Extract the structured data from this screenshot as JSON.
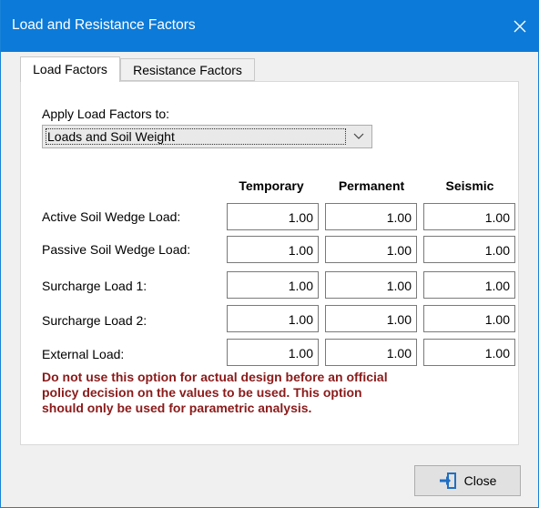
{
  "window": {
    "title": "Load and Resistance Factors"
  },
  "tabs": [
    {
      "label": "Load Factors",
      "active": true
    },
    {
      "label": "Resistance Factors",
      "active": false
    }
  ],
  "apply": {
    "label": "Apply Load Factors to:",
    "selected": "Loads and Soil Weight"
  },
  "columns": [
    "Temporary",
    "Permanent",
    "Seismic"
  ],
  "rows": [
    {
      "label": "Active Soil Wedge Load:",
      "values": [
        "1.00",
        "1.00",
        "1.00"
      ]
    },
    {
      "label": "Passive Soil Wedge Load:",
      "values": [
        "1.00",
        "1.00",
        "1.00"
      ]
    },
    {
      "label": "Surcharge Load 1:",
      "values": [
        "1.00",
        "1.00",
        "1.00"
      ]
    },
    {
      "label": "Surcharge Load 2:",
      "values": [
        "1.00",
        "1.00",
        "1.00"
      ]
    },
    {
      "label": "External Load:",
      "values": [
        "1.00",
        "1.00",
        "1.00"
      ]
    }
  ],
  "warning": {
    "lines": [
      "Do not use this option for actual design before an official",
      "policy decision on the values to be used.  This option",
      "should only be used for parametric analysis."
    ],
    "color": "#8b1a1a"
  },
  "footer": {
    "close_label": "Close",
    "close_icon": "exit-door-icon"
  },
  "colors": {
    "titlebar": "#0c7ad8",
    "icon_blue": "#1f6fc4"
  }
}
